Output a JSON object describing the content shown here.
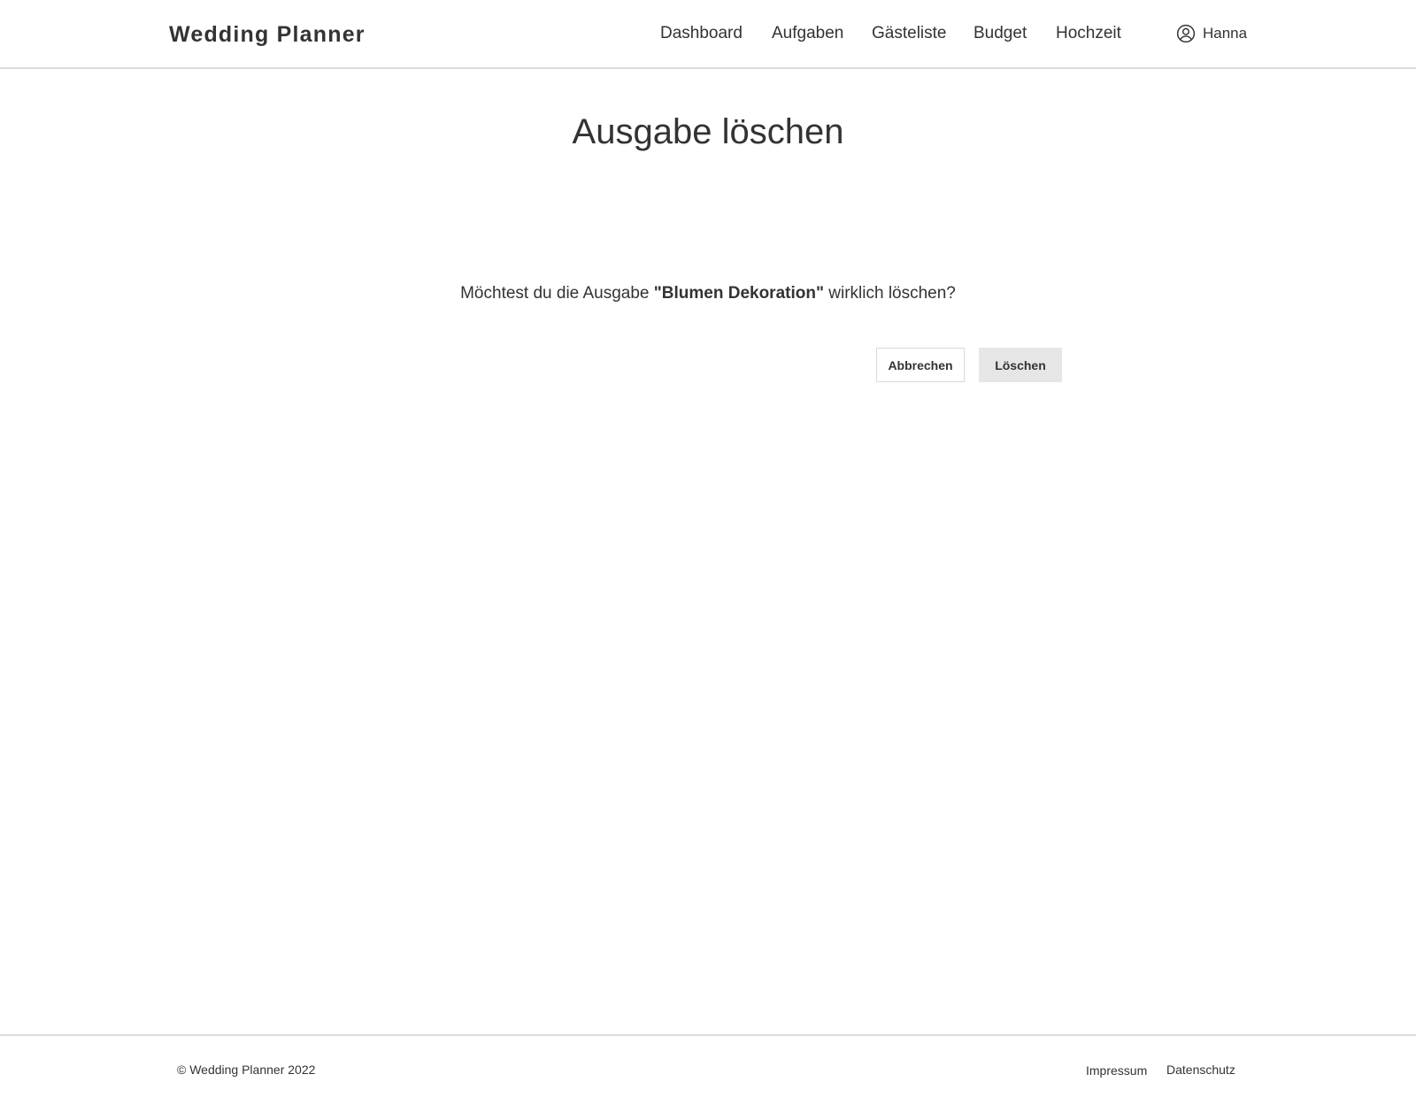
{
  "header": {
    "brand": "Wedding Planner",
    "nav": [
      {
        "label": "Dashboard"
      },
      {
        "label": "Aufgaben"
      },
      {
        "label": "Gästeliste"
      },
      {
        "label": "Budget"
      },
      {
        "label": "Hochzeit"
      }
    ],
    "user": {
      "name": "Hanna",
      "icon": "user-circle-icon"
    }
  },
  "main": {
    "title": "Ausgabe löschen",
    "question": {
      "prefix": "Möchtest du die Ausgabe ",
      "item_name": "\"Blumen Dekoration\"",
      "suffix": " wirklich löschen?"
    },
    "buttons": {
      "cancel_label": "Abbrechen",
      "delete_label": "Löschen"
    }
  },
  "footer": {
    "copyright": "© Wedding Planner 2022",
    "links": [
      {
        "label": "Impressum"
      },
      {
        "label": "Datenschutz"
      }
    ]
  },
  "colors": {
    "text": "#333333",
    "border": "#dcdcdc",
    "delete_button_bg": "#e6e6e6",
    "background": "#ffffff"
  }
}
